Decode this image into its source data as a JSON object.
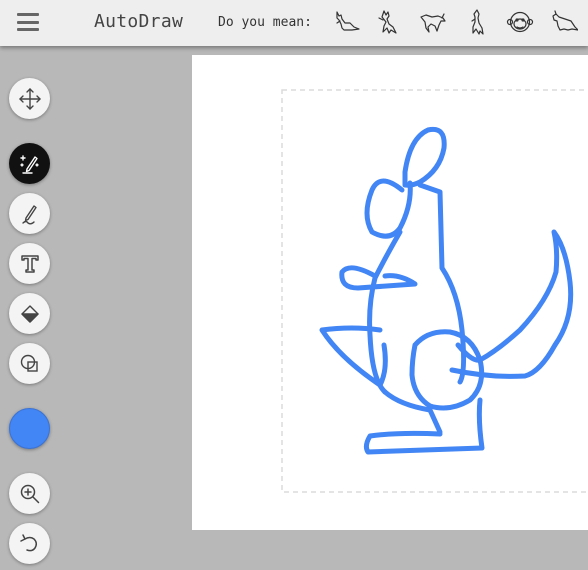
{
  "app": {
    "title": "AutoDraw"
  },
  "header": {
    "suggest_label": "Do you mean:",
    "suggestions": [
      "kangaroo",
      "kangaroo",
      "kangaroo",
      "kangaroo",
      "monkey",
      "kangaroo"
    ]
  },
  "toolbar": {
    "tools": [
      "select",
      "autodraw",
      "draw",
      "type",
      "fill",
      "shape"
    ],
    "active_tool": "autodraw",
    "bottom_tools": [
      "zoom",
      "undo"
    ],
    "color": "#4285f4"
  },
  "canvas": {
    "background": "#ffffff",
    "stroke_color": "#4285f4",
    "selection_border": "dashed"
  }
}
